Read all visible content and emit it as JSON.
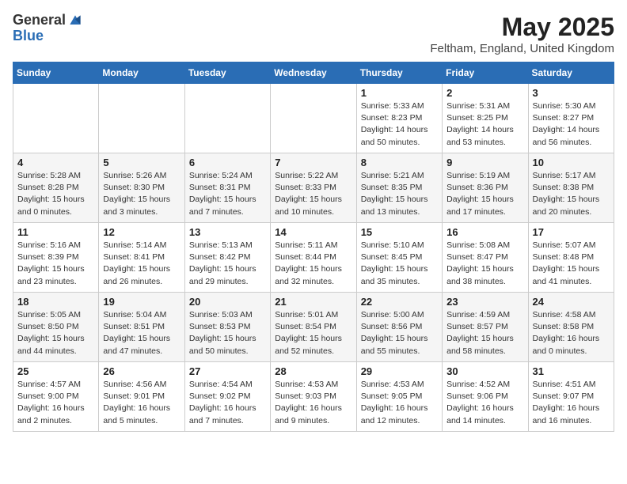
{
  "header": {
    "logo_line1": "General",
    "logo_line2": "Blue",
    "month": "May 2025",
    "location": "Feltham, England, United Kingdom"
  },
  "days_of_week": [
    "Sunday",
    "Monday",
    "Tuesday",
    "Wednesday",
    "Thursday",
    "Friday",
    "Saturday"
  ],
  "weeks": [
    [
      {
        "day": "",
        "text": ""
      },
      {
        "day": "",
        "text": ""
      },
      {
        "day": "",
        "text": ""
      },
      {
        "day": "",
        "text": ""
      },
      {
        "day": "1",
        "text": "Sunrise: 5:33 AM\nSunset: 8:23 PM\nDaylight: 14 hours\nand 50 minutes."
      },
      {
        "day": "2",
        "text": "Sunrise: 5:31 AM\nSunset: 8:25 PM\nDaylight: 14 hours\nand 53 minutes."
      },
      {
        "day": "3",
        "text": "Sunrise: 5:30 AM\nSunset: 8:27 PM\nDaylight: 14 hours\nand 56 minutes."
      }
    ],
    [
      {
        "day": "4",
        "text": "Sunrise: 5:28 AM\nSunset: 8:28 PM\nDaylight: 15 hours\nand 0 minutes."
      },
      {
        "day": "5",
        "text": "Sunrise: 5:26 AM\nSunset: 8:30 PM\nDaylight: 15 hours\nand 3 minutes."
      },
      {
        "day": "6",
        "text": "Sunrise: 5:24 AM\nSunset: 8:31 PM\nDaylight: 15 hours\nand 7 minutes."
      },
      {
        "day": "7",
        "text": "Sunrise: 5:22 AM\nSunset: 8:33 PM\nDaylight: 15 hours\nand 10 minutes."
      },
      {
        "day": "8",
        "text": "Sunrise: 5:21 AM\nSunset: 8:35 PM\nDaylight: 15 hours\nand 13 minutes."
      },
      {
        "day": "9",
        "text": "Sunrise: 5:19 AM\nSunset: 8:36 PM\nDaylight: 15 hours\nand 17 minutes."
      },
      {
        "day": "10",
        "text": "Sunrise: 5:17 AM\nSunset: 8:38 PM\nDaylight: 15 hours\nand 20 minutes."
      }
    ],
    [
      {
        "day": "11",
        "text": "Sunrise: 5:16 AM\nSunset: 8:39 PM\nDaylight: 15 hours\nand 23 minutes."
      },
      {
        "day": "12",
        "text": "Sunrise: 5:14 AM\nSunset: 8:41 PM\nDaylight: 15 hours\nand 26 minutes."
      },
      {
        "day": "13",
        "text": "Sunrise: 5:13 AM\nSunset: 8:42 PM\nDaylight: 15 hours\nand 29 minutes."
      },
      {
        "day": "14",
        "text": "Sunrise: 5:11 AM\nSunset: 8:44 PM\nDaylight: 15 hours\nand 32 minutes."
      },
      {
        "day": "15",
        "text": "Sunrise: 5:10 AM\nSunset: 8:45 PM\nDaylight: 15 hours\nand 35 minutes."
      },
      {
        "day": "16",
        "text": "Sunrise: 5:08 AM\nSunset: 8:47 PM\nDaylight: 15 hours\nand 38 minutes."
      },
      {
        "day": "17",
        "text": "Sunrise: 5:07 AM\nSunset: 8:48 PM\nDaylight: 15 hours\nand 41 minutes."
      }
    ],
    [
      {
        "day": "18",
        "text": "Sunrise: 5:05 AM\nSunset: 8:50 PM\nDaylight: 15 hours\nand 44 minutes."
      },
      {
        "day": "19",
        "text": "Sunrise: 5:04 AM\nSunset: 8:51 PM\nDaylight: 15 hours\nand 47 minutes."
      },
      {
        "day": "20",
        "text": "Sunrise: 5:03 AM\nSunset: 8:53 PM\nDaylight: 15 hours\nand 50 minutes."
      },
      {
        "day": "21",
        "text": "Sunrise: 5:01 AM\nSunset: 8:54 PM\nDaylight: 15 hours\nand 52 minutes."
      },
      {
        "day": "22",
        "text": "Sunrise: 5:00 AM\nSunset: 8:56 PM\nDaylight: 15 hours\nand 55 minutes."
      },
      {
        "day": "23",
        "text": "Sunrise: 4:59 AM\nSunset: 8:57 PM\nDaylight: 15 hours\nand 58 minutes."
      },
      {
        "day": "24",
        "text": "Sunrise: 4:58 AM\nSunset: 8:58 PM\nDaylight: 16 hours\nand 0 minutes."
      }
    ],
    [
      {
        "day": "25",
        "text": "Sunrise: 4:57 AM\nSunset: 9:00 PM\nDaylight: 16 hours\nand 2 minutes."
      },
      {
        "day": "26",
        "text": "Sunrise: 4:56 AM\nSunset: 9:01 PM\nDaylight: 16 hours\nand 5 minutes."
      },
      {
        "day": "27",
        "text": "Sunrise: 4:54 AM\nSunset: 9:02 PM\nDaylight: 16 hours\nand 7 minutes."
      },
      {
        "day": "28",
        "text": "Sunrise: 4:53 AM\nSunset: 9:03 PM\nDaylight: 16 hours\nand 9 minutes."
      },
      {
        "day": "29",
        "text": "Sunrise: 4:53 AM\nSunset: 9:05 PM\nDaylight: 16 hours\nand 12 minutes."
      },
      {
        "day": "30",
        "text": "Sunrise: 4:52 AM\nSunset: 9:06 PM\nDaylight: 16 hours\nand 14 minutes."
      },
      {
        "day": "31",
        "text": "Sunrise: 4:51 AM\nSunset: 9:07 PM\nDaylight: 16 hours\nand 16 minutes."
      }
    ]
  ]
}
